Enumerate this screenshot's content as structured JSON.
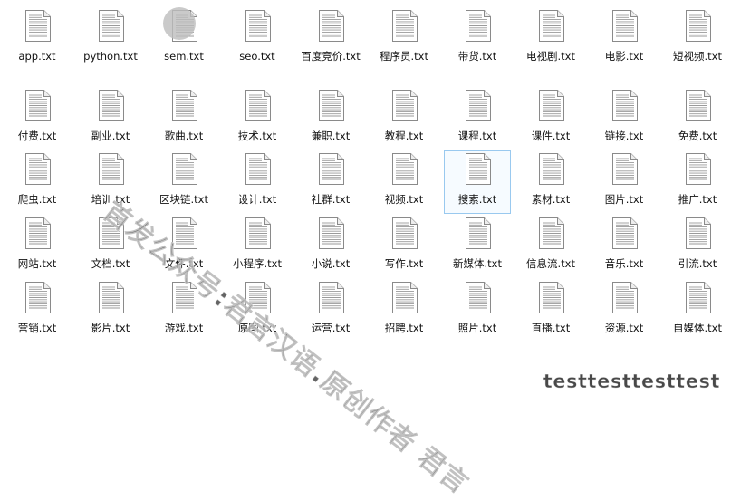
{
  "files": [
    "app.txt",
    "python.txt",
    "sem.txt",
    "seo.txt",
    "百度竞价.txt",
    "程序员.txt",
    "带货.txt",
    "电视剧.txt",
    "电影.txt",
    "短视频.txt",
    "付费.txt",
    "副业.txt",
    "歌曲.txt",
    "技术.txt",
    "兼职.txt",
    "教程.txt",
    "课程.txt",
    "课件.txt",
    "链接.txt",
    "免费.txt",
    "爬虫.txt",
    "培训.txt",
    "区块链.txt",
    "设计.txt",
    "社群.txt",
    "视频.txt",
    "搜索.txt",
    "素材.txt",
    "图片.txt",
    "推广.txt",
    "网站.txt",
    "文档.txt",
    "文件.txt",
    "小程序.txt",
    "小说.txt",
    "写作.txt",
    "新媒体.txt",
    "信息流.txt",
    "音乐.txt",
    "引流.txt",
    "营销.txt",
    "影片.txt",
    "游戏.txt",
    "原图.txt",
    "运营.txt",
    "招聘.txt",
    "照片.txt",
    "直播.txt",
    "资源.txt",
    "自媒体.txt"
  ],
  "selected_file": "搜索.txt",
  "file_icon": "text-document-icon",
  "watermark": {
    "diagonal_text": "首发公众号:君言汉语.原创作者 君言",
    "corner_text": "testtesttesttest"
  },
  "colors": {
    "selection_border": "#99c9ef",
    "text": "#111111"
  }
}
